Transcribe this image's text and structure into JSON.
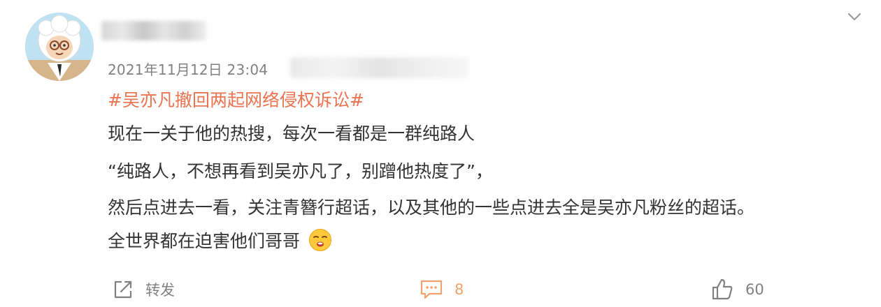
{
  "post": {
    "timestamp": "2021年11月12日 23:04",
    "hashtag": "#吴亦凡撤回两起网络侵权诉讼#",
    "lines": [
      "现在一关于他的热搜，每次一看都是一群纯路人",
      "“纯路人，不想再看到吴亦凡了，别蹭他热度了”，",
      "然后点进去一看，关注青簪行超话，以及其他的一些点进去全是吴亦凡粉丝的超话。",
      "全世界都在迫害他们哥哥"
    ],
    "emoji": "smirk-emoji"
  },
  "actions": {
    "repost_label": "转发",
    "comment_count": "8",
    "like_count": "60"
  },
  "colors": {
    "hashtag": "#eb7350",
    "text": "#333333",
    "meta": "#808080",
    "comment_accent": "#f1a16b"
  }
}
